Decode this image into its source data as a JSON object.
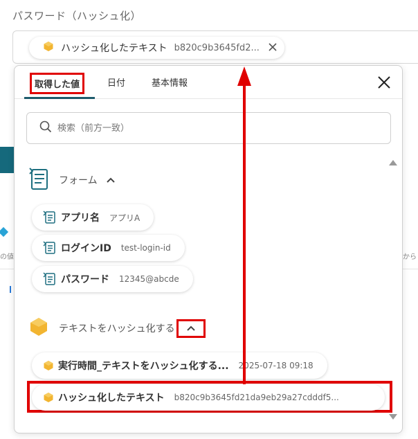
{
  "field": {
    "label": "パスワード（ハッシュ化）",
    "chip": {
      "name": "ハッシュ化したテキスト",
      "value": "b820c9b3645fd2..."
    }
  },
  "background": {
    "left_snippet": "の値",
    "right_snippet": "から"
  },
  "popup": {
    "tabs": [
      {
        "label": "取得した値"
      },
      {
        "label": "日付"
      },
      {
        "label": "基本情報"
      }
    ],
    "search_placeholder": "検索（前方一致）",
    "groups": [
      {
        "title": "フォーム",
        "items": [
          {
            "name": "アプリ名",
            "value": "アプリA"
          },
          {
            "name": "ログインID",
            "value": "test-login-id"
          },
          {
            "name": "パスワード",
            "value": "12345@abcde"
          }
        ]
      },
      {
        "title": "テキストをハッシュ化する",
        "items": [
          {
            "name": "実行時間_テキストをハッシュ化する...",
            "value": "2025-07-18 09:18"
          },
          {
            "name": "ハッシュ化したテキスト",
            "value": "b820c9b3645fd21da9eb29a27cdddf5..."
          }
        ]
      }
    ]
  },
  "colors": {
    "highlight": "#e00000",
    "tab_underline": "#1e5b6c",
    "form_icon": "#1e6f80",
    "hex_icon": "#f2b531"
  }
}
